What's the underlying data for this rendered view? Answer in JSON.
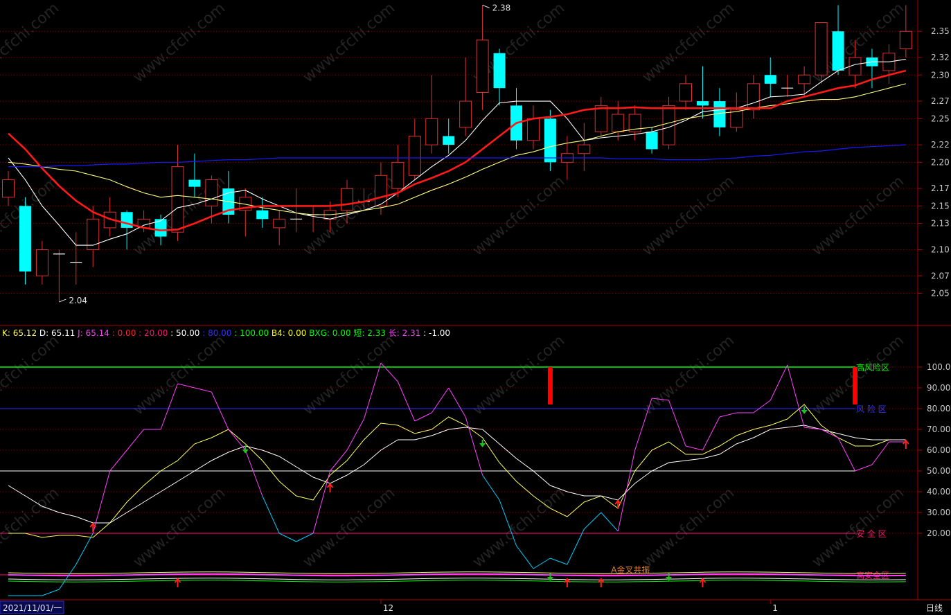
{
  "colors": {
    "background": "#000000",
    "grid": "#7a0000",
    "frame": "#b00000",
    "axis_text": "#c8c8c8",
    "candle_up": "#e03030",
    "candle_down": "#00ffff",
    "ma5": "#ffffff",
    "ma10": "#ffff80",
    "ma20": "#ff1a1a",
    "ma60": "#1a1aff",
    "k": "#ffff60",
    "d": "#ffffff",
    "j": "#ff40ff",
    "j_low": "#00d0ff",
    "high_risk": "#00ff00",
    "risk": "#3030ff",
    "safe": "#ff1070",
    "arrow_up": "#ff2020",
    "arrow_down": "#20c020"
  },
  "watermark": "www.cfchi.com",
  "chart_data": [
    {
      "type": "candlestick",
      "panel": "price",
      "y_ticks": [
        "2.35",
        "2.32",
        "2.30",
        "2.27",
        "2.25",
        "2.22",
        "2.20",
        "2.17",
        "2.15",
        "2.13",
        "2.10",
        "2.07",
        "2.05"
      ],
      "ylim": [
        2.025,
        2.37
      ],
      "high_label": "2.38",
      "low_label": "2.04",
      "candles": [
        {
          "o": 2.16,
          "c": 2.18,
          "h": 2.19,
          "l": 2.15
        },
        {
          "o": 2.15,
          "c": 2.075,
          "h": 2.16,
          "l": 2.06
        },
        {
          "o": 2.07,
          "c": 2.1,
          "h": 2.11,
          "l": 2.06
        },
        {
          "o": 2.095,
          "c": 2.095,
          "h": 2.1,
          "l": 2.04
        },
        {
          "o": 2.085,
          "c": 2.085,
          "h": 2.12,
          "l": 2.06
        },
        {
          "o": 2.1,
          "c": 2.135,
          "h": 2.15,
          "l": 2.08
        },
        {
          "o": 2.125,
          "c": 2.143,
          "h": 2.16,
          "l": 2.115
        },
        {
          "o": 2.143,
          "c": 2.125,
          "h": 2.145,
          "l": 2.1
        },
        {
          "o": 2.125,
          "c": 2.135,
          "h": 2.145,
          "l": 2.12
        },
        {
          "o": 2.135,
          "c": 2.115,
          "h": 2.14,
          "l": 2.105
        },
        {
          "o": 2.12,
          "c": 2.195,
          "h": 2.22,
          "l": 2.11
        },
        {
          "o": 2.18,
          "c": 2.172,
          "h": 2.21,
          "l": 2.16
        },
        {
          "o": 2.15,
          "c": 2.18,
          "h": 2.185,
          "l": 2.13
        },
        {
          "o": 2.17,
          "c": 2.14,
          "h": 2.19,
          "l": 2.13
        },
        {
          "o": 2.145,
          "c": 2.16,
          "h": 2.17,
          "l": 2.115
        },
        {
          "o": 2.145,
          "c": 2.135,
          "h": 2.16,
          "l": 2.125
        },
        {
          "o": 2.125,
          "c": 2.135,
          "h": 2.145,
          "l": 2.105
        },
        {
          "o": 2.135,
          "c": 2.135,
          "h": 2.17,
          "l": 2.12
        },
        {
          "o": 2.14,
          "c": 2.14,
          "h": 2.15,
          "l": 2.12
        },
        {
          "o": 2.135,
          "c": 2.145,
          "h": 2.155,
          "l": 2.12
        },
        {
          "o": 2.145,
          "c": 2.17,
          "h": 2.18,
          "l": 2.13
        },
        {
          "o": 2.155,
          "c": 2.155,
          "h": 2.17,
          "l": 2.145
        },
        {
          "o": 2.15,
          "c": 2.185,
          "h": 2.2,
          "l": 2.14
        },
        {
          "o": 2.17,
          "c": 2.2,
          "h": 2.22,
          "l": 2.16
        },
        {
          "o": 2.185,
          "c": 2.23,
          "h": 2.25,
          "l": 2.18
        },
        {
          "o": 2.22,
          "c": 2.25,
          "h": 2.3,
          "l": 2.21
        },
        {
          "o": 2.23,
          "c": 2.22,
          "h": 2.25,
          "l": 2.21
        },
        {
          "o": 2.24,
          "c": 2.27,
          "h": 2.32,
          "l": 2.23
        },
        {
          "o": 2.28,
          "c": 2.34,
          "h": 2.38,
          "l": 2.26
        },
        {
          "o": 2.325,
          "c": 2.285,
          "h": 2.33,
          "l": 2.265
        },
        {
          "o": 2.265,
          "c": 2.225,
          "h": 2.285,
          "l": 2.215
        },
        {
          "o": 2.225,
          "c": 2.25,
          "h": 2.265,
          "l": 2.215
        },
        {
          "o": 2.25,
          "c": 2.2,
          "h": 2.26,
          "l": 2.19
        },
        {
          "o": 2.2,
          "c": 2.21,
          "h": 2.23,
          "l": 2.18
        },
        {
          "o": 2.21,
          "c": 2.22,
          "h": 2.245,
          "l": 2.19
        },
        {
          "o": 2.235,
          "c": 2.265,
          "h": 2.275,
          "l": 2.23
        },
        {
          "o": 2.235,
          "c": 2.255,
          "h": 2.27,
          "l": 2.225
        },
        {
          "o": 2.235,
          "c": 2.255,
          "h": 2.265,
          "l": 2.225
        },
        {
          "o": 2.235,
          "c": 2.215,
          "h": 2.24,
          "l": 2.21
        },
        {
          "o": 2.22,
          "c": 2.265,
          "h": 2.275,
          "l": 2.215
        },
        {
          "o": 2.27,
          "c": 2.29,
          "h": 2.3,
          "l": 2.26
        },
        {
          "o": 2.27,
          "c": 2.265,
          "h": 2.31,
          "l": 2.25
        },
        {
          "o": 2.27,
          "c": 2.24,
          "h": 2.285,
          "l": 2.23
        },
        {
          "o": 2.24,
          "c": 2.26,
          "h": 2.28,
          "l": 2.235
        },
        {
          "o": 2.26,
          "c": 2.29,
          "h": 2.3,
          "l": 2.25
        },
        {
          "o": 2.3,
          "c": 2.29,
          "h": 2.32,
          "l": 2.275
        },
        {
          "o": 2.285,
          "c": 2.285,
          "h": 2.3,
          "l": 2.275
        },
        {
          "o": 2.29,
          "c": 2.3,
          "h": 2.31,
          "l": 2.275
        },
        {
          "o": 2.3,
          "c": 2.36,
          "h": 2.36,
          "l": 2.29
        },
        {
          "o": 2.35,
          "c": 2.305,
          "h": 2.38,
          "l": 2.3
        },
        {
          "o": 2.3,
          "c": 2.32,
          "h": 2.34,
          "l": 2.285
        },
        {
          "o": 2.32,
          "c": 2.31,
          "h": 2.33,
          "l": 2.285
        },
        {
          "o": 2.305,
          "c": 2.325,
          "h": 2.335,
          "l": 2.29
        },
        {
          "o": 2.33,
          "c": 2.35,
          "h": 2.38,
          "l": 2.32
        }
      ],
      "series": [
        {
          "key": "ma5",
          "values": [
            2.205,
            2.18,
            2.15,
            2.128,
            2.105,
            2.105,
            2.112,
            2.118,
            2.128,
            2.133,
            2.148,
            2.152,
            2.158,
            2.165,
            2.168,
            2.158,
            2.15,
            2.142,
            2.138,
            2.135,
            2.14,
            2.145,
            2.152,
            2.165,
            2.18,
            2.195,
            2.208,
            2.225,
            2.248,
            2.268,
            2.27,
            2.27,
            2.27,
            2.25,
            2.225,
            2.228,
            2.23,
            2.232,
            2.235,
            2.24,
            2.248,
            2.258,
            2.26,
            2.262,
            2.268,
            2.275,
            2.276,
            2.278,
            2.292,
            2.305,
            2.312,
            2.315,
            2.315,
            2.318
          ]
        },
        {
          "key": "ma10",
          "values": [
            2.2,
            2.198,
            2.195,
            2.192,
            2.19,
            2.185,
            2.18,
            2.172,
            2.165,
            2.16,
            2.162,
            2.16,
            2.158,
            2.155,
            2.152,
            2.148,
            2.145,
            2.142,
            2.14,
            2.14,
            2.142,
            2.145,
            2.148,
            2.152,
            2.16,
            2.168,
            2.175,
            2.183,
            2.192,
            2.2,
            2.208,
            2.212,
            2.218,
            2.222,
            2.225,
            2.23,
            2.235,
            2.238,
            2.24,
            2.245,
            2.25,
            2.253,
            2.256,
            2.258,
            2.262,
            2.265,
            2.267,
            2.27,
            2.272,
            2.272,
            2.275,
            2.28,
            2.285,
            2.29
          ]
        },
        {
          "key": "ma20",
          "values": [
            2.233,
            2.215,
            2.193,
            2.173,
            2.156,
            2.143,
            2.135,
            2.13,
            2.125,
            2.122,
            2.123,
            2.13,
            2.138,
            2.145,
            2.148,
            2.15,
            2.15,
            2.15,
            2.15,
            2.15,
            2.152,
            2.155,
            2.16,
            2.165,
            2.175,
            2.182,
            2.19,
            2.2,
            2.215,
            2.23,
            2.245,
            2.25,
            2.252,
            2.255,
            2.26,
            2.262,
            2.262,
            2.263,
            2.262,
            2.262,
            2.262,
            2.262,
            2.262,
            2.262,
            2.262,
            2.262,
            2.27,
            2.275,
            2.28,
            2.285,
            2.288,
            2.295,
            2.3,
            2.305
          ]
        },
        {
          "key": "ma60",
          "values": [
            2.195,
            2.195,
            2.195,
            2.196,
            2.196,
            2.197,
            2.198,
            2.198,
            2.199,
            2.2,
            2.2,
            2.201,
            2.202,
            2.203,
            2.203,
            2.204,
            2.205,
            2.205,
            2.205,
            2.205,
            2.205,
            2.205,
            2.205,
            2.205,
            2.205,
            2.205,
            2.205,
            2.205,
            2.205,
            2.205,
            2.205,
            2.205,
            2.205,
            2.205,
            2.205,
            2.205,
            2.204,
            2.204,
            2.204,
            2.203,
            2.203,
            2.203,
            2.204,
            2.205,
            2.207,
            2.208,
            2.21,
            2.212,
            2.213,
            2.215,
            2.217,
            2.218,
            2.219,
            2.22
          ]
        }
      ]
    },
    {
      "type": "line",
      "panel": "indicator",
      "header": [
        {
          "text": "K: 65.12",
          "color": "#ffff60"
        },
        {
          "text": "D: 65.11",
          "color": "#ffffff"
        },
        {
          "text": "J: 65.14",
          "color": "#ff40ff"
        },
        {
          "text": ": 0.00",
          "color": "#ff2020"
        },
        {
          "text": ": 20.00",
          "color": "#ff1070"
        },
        {
          "text": ": 50.00",
          "color": "#ffffff"
        },
        {
          "text": ": 80.00",
          "color": "#3030ff"
        },
        {
          "text": ": 100.00",
          "color": "#00ff00"
        },
        {
          "text": "B4: 0.00",
          "color": "#ffff00"
        },
        {
          "text": "BXG: 0.00",
          "color": "#00ff00"
        },
        {
          "text": "短: 2.33",
          "color": "#00ff00"
        },
        {
          "text": "长: 2.31",
          "color": "#ff40ff"
        },
        {
          "text": ": -1.00",
          "color": "#ffffff"
        }
      ],
      "y_ticks": [
        "100.00",
        "90.00",
        "80.00",
        "70.00",
        "60.00",
        "50.00",
        "40.00",
        "30.00",
        "20.00"
      ],
      "ylim": [
        -10,
        110
      ],
      "levels": [
        {
          "value": 100,
          "label": "高风险区",
          "key": "high_risk"
        },
        {
          "value": 80,
          "label": "风 险 区",
          "key": "risk"
        },
        {
          "value": 50,
          "label": "",
          "key": "mid"
        },
        {
          "value": 20,
          "label": "安 全 区",
          "key": "safe"
        },
        {
          "value": 0,
          "label": "高安全区",
          "key": "safe"
        }
      ],
      "annotation": "A金叉共振",
      "series": [
        {
          "name": "K",
          "key": "k",
          "values": [
            20,
            20,
            18,
            19,
            19,
            18,
            25,
            35,
            43,
            50,
            55,
            63,
            66,
            70,
            63,
            55,
            45,
            38,
            36,
            48,
            55,
            65,
            73,
            72,
            68,
            70,
            76,
            72,
            66,
            54,
            45,
            38,
            32,
            28,
            35,
            38,
            32,
            50,
            60,
            64,
            58,
            58,
            62,
            67,
            70,
            72,
            75,
            82,
            72,
            66,
            62,
            62,
            65,
            65
          ]
        },
        {
          "name": "D",
          "key": "d",
          "values": [
            43,
            38,
            33,
            30,
            28,
            25,
            25,
            30,
            35,
            40,
            45,
            50,
            55,
            59,
            62,
            60,
            57,
            52,
            47,
            44,
            48,
            53,
            60,
            65,
            65,
            67,
            70,
            71,
            70,
            63,
            56,
            50,
            43,
            40,
            38,
            38,
            36,
            44,
            50,
            54,
            55,
            56,
            58,
            63,
            66,
            70,
            71,
            72,
            70,
            68,
            66,
            65,
            65,
            65
          ]
        },
        {
          "name": "J",
          "key": "j",
          "values": [
            -10,
            -20,
            -11,
            -7,
            5,
            20,
            50,
            60,
            70,
            70,
            92,
            90,
            88,
            70,
            60,
            38,
            20,
            16,
            20,
            50,
            60,
            75,
            102,
            93,
            74,
            78,
            90,
            76,
            48,
            36,
            14,
            3,
            8,
            5,
            22,
            30,
            21,
            60,
            85,
            84,
            62,
            60,
            76,
            78,
            78,
            84,
            101,
            71,
            70,
            66,
            50,
            53,
            64,
            64
          ]
        }
      ],
      "arrows_up": [
        5,
        19,
        36,
        53
      ],
      "arrows_down": [
        14,
        28,
        47
      ],
      "bars": [
        {
          "index": 32,
          "from": 100,
          "to": 82
        },
        {
          "index": 50,
          "from": 100,
          "to": 82
        }
      ],
      "bottom_arrows_up": [
        10,
        33,
        35,
        41
      ],
      "bottom_arrows_down": [
        32,
        39
      ]
    }
  ],
  "x_axis": {
    "start_label": "2021/11/01/一",
    "month_labels": [
      {
        "text": "12",
        "index": 22
      },
      {
        "text": "1",
        "index": 45
      }
    ],
    "period_label": "日线"
  }
}
